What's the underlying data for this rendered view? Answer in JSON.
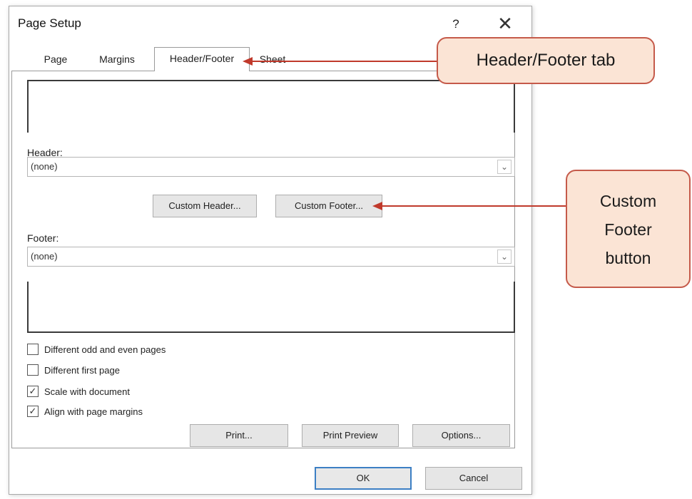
{
  "window": {
    "title": "Page Setup",
    "help_glyph": "?",
    "close_glyph": "✕"
  },
  "tabs": [
    {
      "label": "Page",
      "active": false
    },
    {
      "label": "Margins",
      "active": false
    },
    {
      "label": "Header/Footer",
      "active": true
    },
    {
      "label": "Sheet",
      "active": false
    }
  ],
  "header": {
    "label": "Header:",
    "value": "(none)"
  },
  "buttons": {
    "custom_header": "Custom Header...",
    "custom_footer": "Custom Footer...",
    "print": "Print...",
    "print_preview": "Print Preview",
    "options": "Options...",
    "ok": "OK",
    "cancel": "Cancel"
  },
  "footer": {
    "label": "Footer:",
    "value": "(none)"
  },
  "checkboxes": [
    {
      "label": "Different odd and even pages",
      "checked": false
    },
    {
      "label": "Different first page",
      "checked": false
    },
    {
      "label": "Scale with document",
      "checked": true
    },
    {
      "label": "Align with page margins",
      "checked": true
    }
  ],
  "callouts": {
    "tab": "Header/Footer tab",
    "footer_button": [
      "Custom",
      "Footer",
      "button"
    ]
  },
  "colors": {
    "callout_fill": "#fbe4d5",
    "callout_border": "#c55a4a",
    "arrow": "#c0392b",
    "default_button_border": "#3c7fc4"
  },
  "icons": {
    "combo_arrow": "chevron-down-icon",
    "check": "checkmark-icon"
  }
}
